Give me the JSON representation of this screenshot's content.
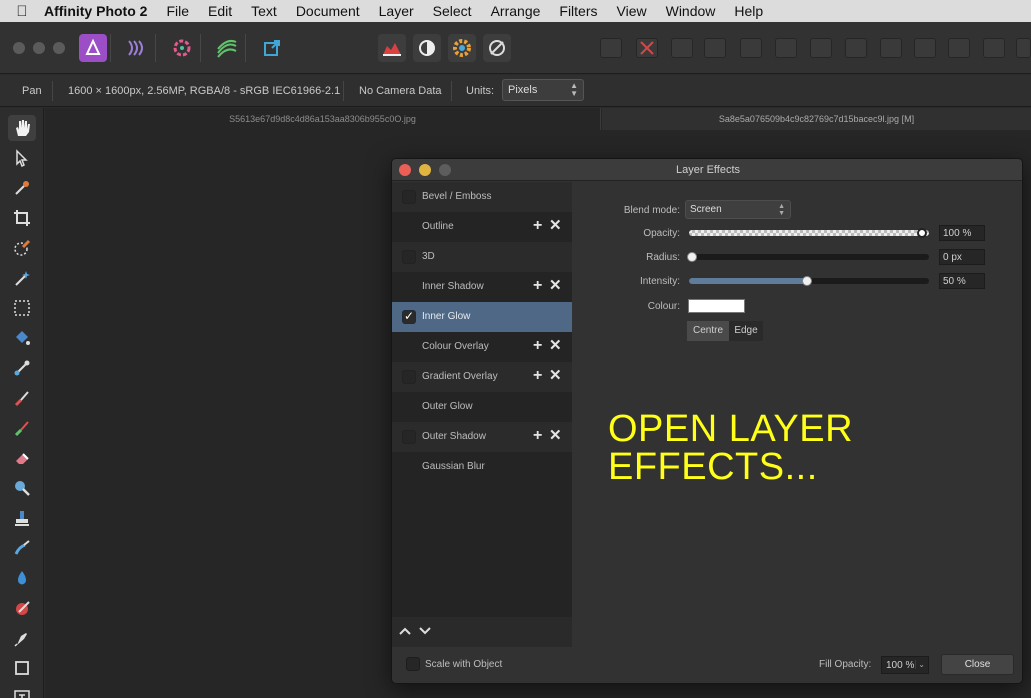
{
  "menubar": {
    "app_name": "Affinity Photo 2",
    "items": [
      "File",
      "Edit",
      "Text",
      "Document",
      "Layer",
      "Select",
      "Arrange",
      "Filters",
      "View",
      "Window",
      "Help"
    ]
  },
  "context_toolbar": {
    "tool_name": "Pan",
    "doc_info": "1600 × 1600px, 2.56MP, RGBA/8 - sRGB IEC61966-2.1",
    "camera": "No Camera Data",
    "units_label": "Units:",
    "units_value": "Pixels"
  },
  "doc_tabs": [
    {
      "label": "S5613e67d9d8c4d86a153aa8306b955c0O.jpg"
    },
    {
      "label": "Sa8e5a076509b4c9c82769c7d15bacec9l.jpg [M]"
    }
  ],
  "dialog": {
    "title": "Layer Effects",
    "effects": [
      {
        "label": "Bevel / Emboss",
        "checked": false
      },
      {
        "label": "Outline",
        "checked": false
      },
      {
        "label": "3D",
        "checked": false
      },
      {
        "label": "Inner Shadow",
        "checked": false
      },
      {
        "label": "Inner Glow",
        "checked": true
      },
      {
        "label": "Colour Overlay",
        "checked": false
      },
      {
        "label": "Gradient Overlay",
        "checked": false
      },
      {
        "label": "Outer Glow",
        "checked": false
      },
      {
        "label": "Outer Shadow",
        "checked": false
      },
      {
        "label": "Gaussian Blur",
        "checked": false
      }
    ],
    "settings": {
      "blend_mode_label": "Blend mode:",
      "blend_mode_value": "Screen",
      "opacity_label": "Opacity:",
      "opacity_value": "100 %",
      "opacity_level": 1.0,
      "radius_label": "Radius:",
      "radius_value": "0 px",
      "radius_level": 0.0,
      "intensity_label": "Intensity:",
      "intensity_value": "50 %",
      "intensity_level": 0.5,
      "colour_label": "Colour:",
      "colour_value": "#ffffff",
      "centre_label": "Centre",
      "edge_label": "Edge"
    },
    "overlay_text_line1": "OPEN LAYER",
    "overlay_text_line2": "EFFECTS...",
    "scale_with_object_label": "Scale with Object",
    "fill_opacity_label": "Fill Opacity:",
    "fill_opacity_value": "100 %",
    "close_label": "Close"
  },
  "colors": {
    "selected_row": "#4f6886",
    "overlay_text": "#ffff1a",
    "persona_active": "#9b4ec5"
  }
}
